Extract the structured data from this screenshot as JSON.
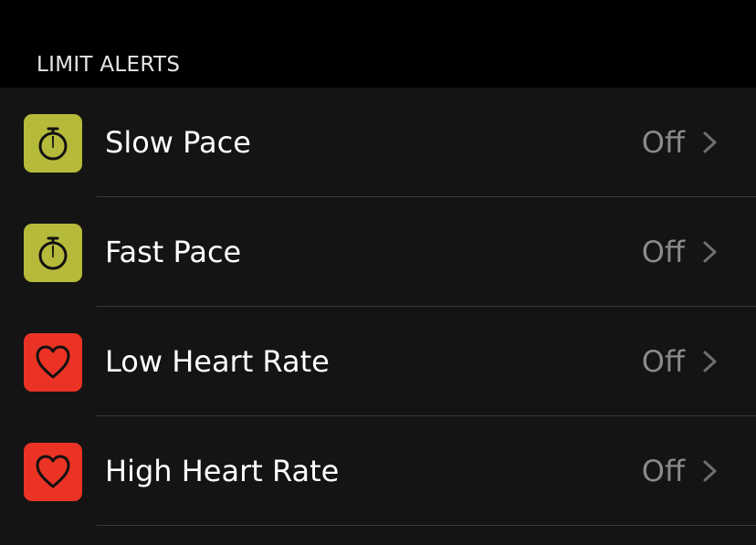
{
  "section": {
    "header": "LIMIT ALERTS"
  },
  "alerts": [
    {
      "label": "Slow Pace",
      "value": "Off",
      "icon": "stopwatch-icon",
      "icon_color": "#b6ba3a"
    },
    {
      "label": "Fast Pace",
      "value": "Off",
      "icon": "stopwatch-icon",
      "icon_color": "#b6ba3a"
    },
    {
      "label": "Low Heart Rate",
      "value": "Off",
      "icon": "heart-icon",
      "icon_color": "#ea3324"
    },
    {
      "label": "High Heart Rate",
      "value": "Off",
      "icon": "heart-icon",
      "icon_color": "#ea3324"
    }
  ],
  "colors": {
    "background": "#000000",
    "list_background": "#141414",
    "label_text": "#ffffff",
    "value_text": "#8a8a8e",
    "separator": "#3a3a3c"
  }
}
